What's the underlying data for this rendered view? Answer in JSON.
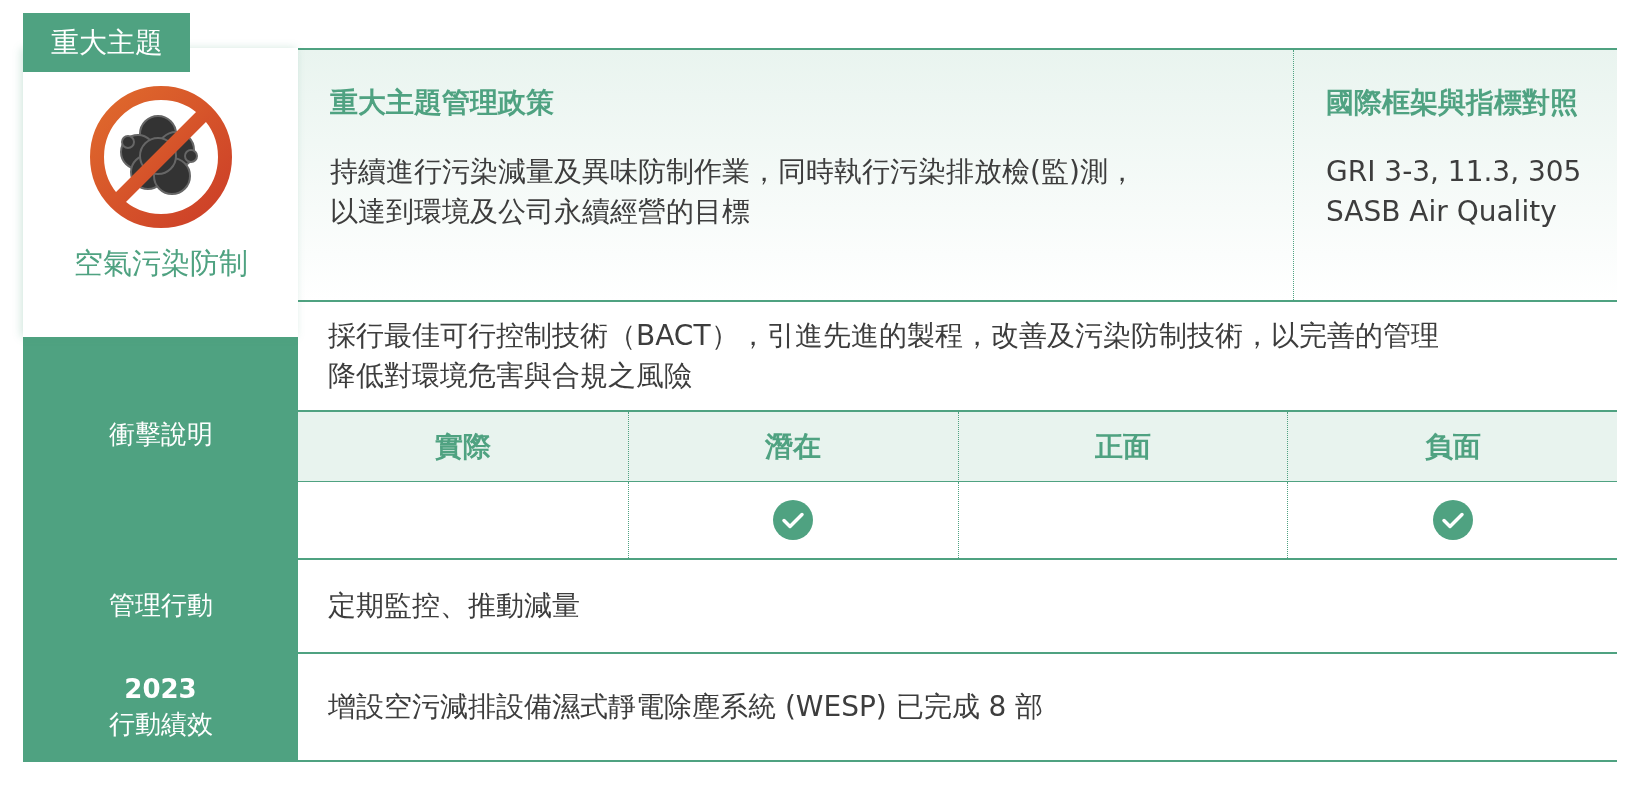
{
  "topic_tag": "重大主題",
  "topic": {
    "name": "空氣污染防制"
  },
  "policy": {
    "heading": "重大主題管理政策",
    "lines": [
      "持續進行污染減量及異味防制作業，同時執行污染排放檢(監)測，",
      "以達到環境及公司永續經營的目標"
    ]
  },
  "frameworks": {
    "heading": "國際框架與指標對照",
    "lines": [
      "GRI 3-3, 11.3, 305",
      "SASB Air Quality"
    ]
  },
  "impact": {
    "label": "衝擊說明",
    "lines": [
      "採行最佳可行控制技術（BACT），引進先進的製程，改善及污染防制技術，以完善的管理",
      "降低對環境危害與合規之風險"
    ],
    "columns": [
      {
        "label": "實際",
        "checked": false
      },
      {
        "label": "潛在",
        "checked": true
      },
      {
        "label": "正面",
        "checked": false
      },
      {
        "label": "負面",
        "checked": true
      }
    ]
  },
  "rows": [
    {
      "label_lines": [
        "管理行動"
      ],
      "value": "定期監控、推動減量"
    },
    {
      "label_lines": [
        "2023",
        "行動績效"
      ],
      "value": "增設空污減排設備濕式靜電除塵系統 (WESP) 已完成 8 部"
    }
  ]
}
